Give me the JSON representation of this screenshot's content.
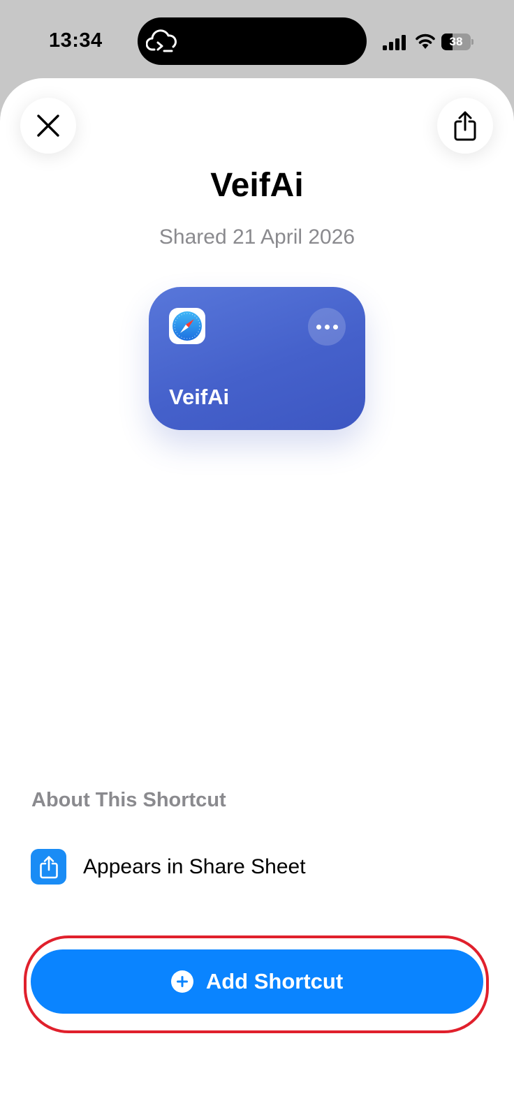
{
  "status_bar": {
    "time": "13:34",
    "battery_level": "38",
    "island_icon": "cloud-terminal-icon",
    "signal_icon": "cellular-signal-icon",
    "wifi_icon": "wifi-icon"
  },
  "header": {
    "close_icon": "close-icon",
    "share_icon": "share-icon"
  },
  "shortcut": {
    "title": "VeifAi",
    "shared_date": "Shared 21 April 2026",
    "card_label": "VeifAi",
    "card_icon": "safari-compass-icon",
    "card_more_icon": "ellipsis-icon"
  },
  "about": {
    "heading": "About This Shortcut",
    "items": [
      {
        "icon": "share-sheet-icon",
        "label": "Appears in Share Sheet"
      }
    ]
  },
  "actions": {
    "add_label": "Add Shortcut",
    "add_icon": "plus-circle-icon"
  },
  "colors": {
    "accent": "#0a84ff",
    "card_blue": "#4561cb",
    "highlight": "#e0202c",
    "secondary_text": "#8a8a8e"
  }
}
